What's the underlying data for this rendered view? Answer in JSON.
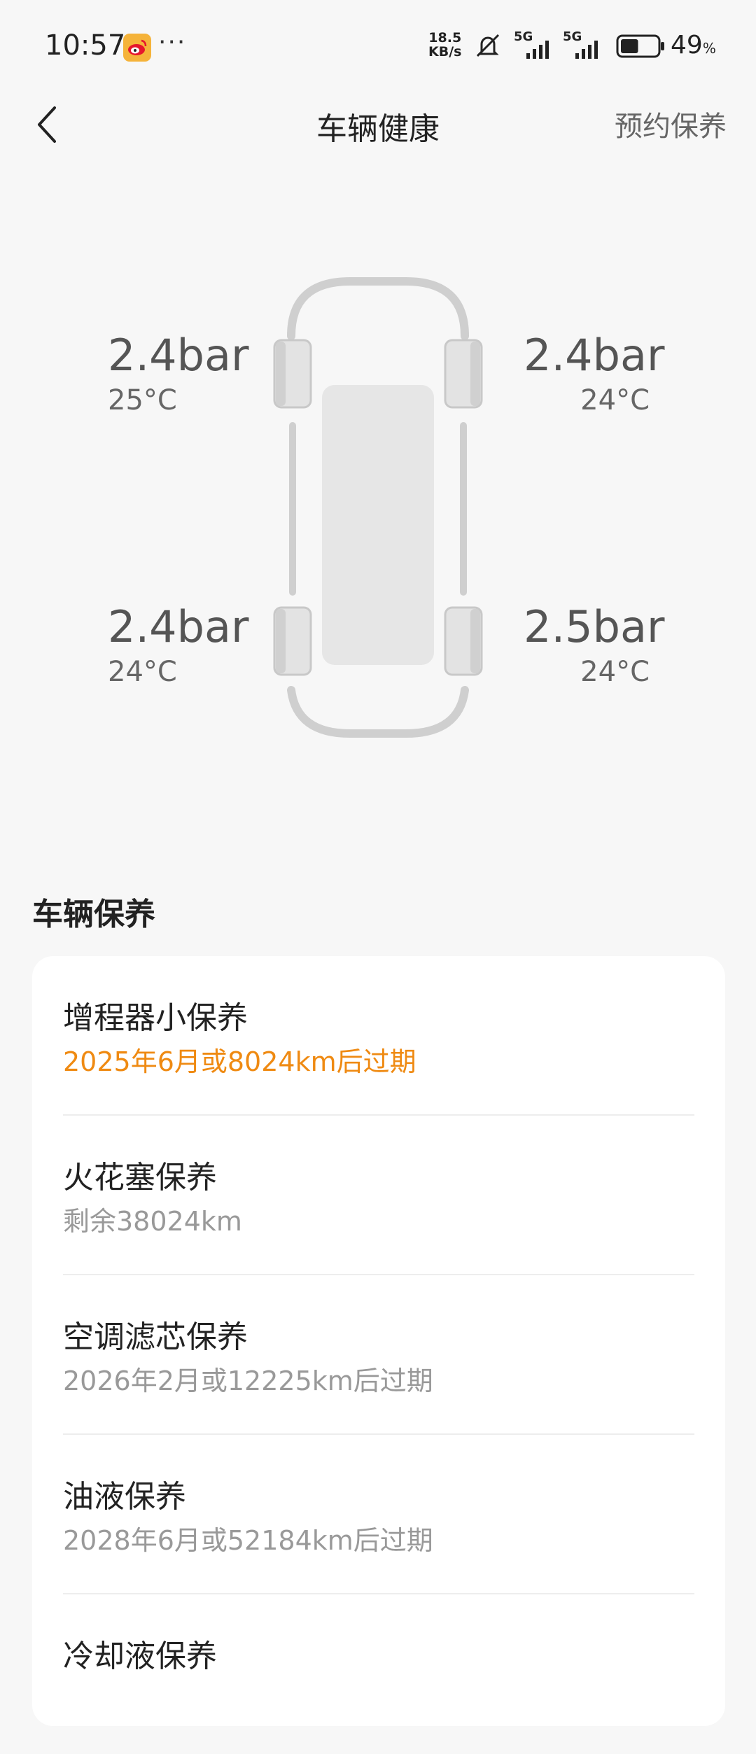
{
  "status_bar": {
    "time": "10:57",
    "net_speed_top": "18.5",
    "net_speed_bottom": "KB/s",
    "signal_1": "5G",
    "signal_2": "5G",
    "battery": "49",
    "battery_unit": "%",
    "battery_level": 0.49
  },
  "header": {
    "title": "车辆健康",
    "action": "预约保养"
  },
  "tires": {
    "front_left": {
      "pressure": "2.4bar",
      "temp": "25°C"
    },
    "front_right": {
      "pressure": "2.4bar",
      "temp": "24°C"
    },
    "rear_left": {
      "pressure": "2.4bar",
      "temp": "24°C"
    },
    "rear_right": {
      "pressure": "2.5bar",
      "temp": "24°C"
    }
  },
  "maintenance": {
    "title": "车辆保养",
    "items": [
      {
        "name": "增程器小保养",
        "status": "2025年6月或8024km后过期"
      },
      {
        "name": "火花塞保养",
        "status": "剩余38024km"
      },
      {
        "name": "空调滤芯保养",
        "status": "2026年2月或12225km后过期"
      },
      {
        "name": "油液保养",
        "status": "2028年6月或52184km后过期"
      },
      {
        "name": "冷却液保养",
        "status": ""
      }
    ]
  },
  "colors": {
    "warning": "#ef8a12",
    "background": "#f7f7f7",
    "icons": [
      "weibo-icon",
      "mute-icon",
      "signal-icon",
      "battery-icon",
      "back-arrow-icon"
    ]
  }
}
